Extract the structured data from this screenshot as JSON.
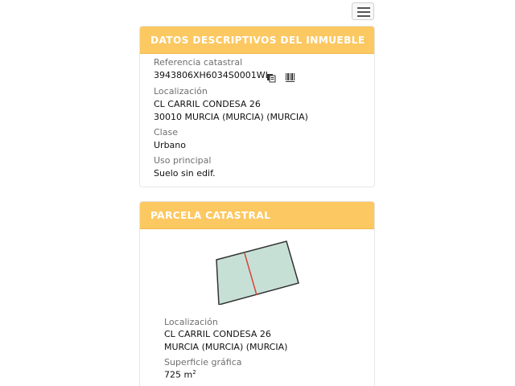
{
  "header": {
    "menu_icon": "hamburger-menu-icon"
  },
  "inmueble": {
    "title": "DATOS DESCRIPTIVOS DEL INMUEBLE",
    "referencia_label": "Referencia catastral",
    "referencia_value": "3943806XH6034S0001WL",
    "copy_icon": "copy-icon",
    "barcode_icon": "barcode-icon",
    "localizacion_label": "Localización",
    "localizacion_line1": "CL CARRIL CONDESA 26",
    "localizacion_line2": "30010 MURCIA (MURCIA) (MURCIA)",
    "clase_label": "Clase",
    "clase_value": "Urbano",
    "uso_label": "Uso principal",
    "uso_value": "Suelo sin edif."
  },
  "parcela": {
    "title": "PARCELA CATASTRAL",
    "localizacion_label": "Localización",
    "localizacion_line1": "CL CARRIL CONDESA 26",
    "localizacion_line2": "MURCIA (MURCIA) (MURCIA)",
    "superficie_label": "Superficie gráfica",
    "superficie_value": "725 m",
    "superficie_unit_sup": "2"
  },
  "colors": {
    "header_bg": "#fcc861",
    "parcel_fill": "#c7e0d6",
    "parcel_stroke": "#333333",
    "parcel_divider": "#d6453a"
  }
}
